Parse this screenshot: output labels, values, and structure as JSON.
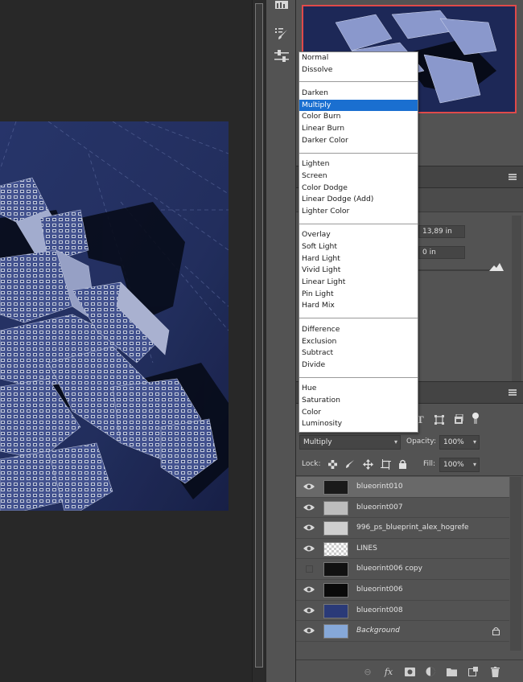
{
  "blend_dropdown": {
    "groups": [
      [
        "Normal",
        "Dissolve"
      ],
      [
        "Darken",
        "Multiply",
        "Color Burn",
        "Linear Burn",
        "Darker Color"
      ],
      [
        "Lighten",
        "Screen",
        "Color Dodge",
        "Linear Dodge (Add)",
        "Lighter Color"
      ],
      [
        "Overlay",
        "Soft Light",
        "Hard Light",
        "Vivid Light",
        "Linear Light",
        "Pin Light",
        "Hard Mix"
      ],
      [
        "Difference",
        "Exclusion",
        "Subtract",
        "Divide"
      ],
      [
        "Hue",
        "Saturation",
        "Color",
        "Luminosity"
      ]
    ],
    "selected": "Multiply"
  },
  "properties": {
    "field_1": "13,89 in",
    "field_2": "0 in"
  },
  "layers_panel": {
    "blend_mode": "Multiply",
    "opacity_label": "Opacity:",
    "opacity_value": "100%",
    "lock_label": "Lock:",
    "fill_label": "Fill:",
    "fill_value": "100%",
    "layers": [
      {
        "name": "blueorint010",
        "visible": true,
        "selected": true,
        "thumb": "#1a1a1a"
      },
      {
        "name": "blueorint007",
        "visible": true,
        "selected": false,
        "thumb": "#bdbdbd"
      },
      {
        "name": "996_ps_blueprint_alex_hogrefe",
        "visible": true,
        "selected": false,
        "thumb": "#cfcfcf"
      },
      {
        "name": "LINES",
        "visible": true,
        "selected": false,
        "thumb": "checker"
      },
      {
        "name": "blueorint006 copy",
        "visible": false,
        "selected": false,
        "thumb": "#111111"
      },
      {
        "name": "blueorint006",
        "visible": true,
        "selected": false,
        "thumb": "#0a0a0a"
      },
      {
        "name": "blueorint008",
        "visible": true,
        "selected": false,
        "thumb": "#2a3a78"
      },
      {
        "name": "Background",
        "visible": true,
        "selected": false,
        "thumb": "#86a8d8",
        "locked": true,
        "italic": true
      }
    ]
  },
  "colors": {
    "panel_bg": "#535353",
    "selection_blue": "#1a6fd0",
    "navigator_border": "#e04a4a"
  }
}
